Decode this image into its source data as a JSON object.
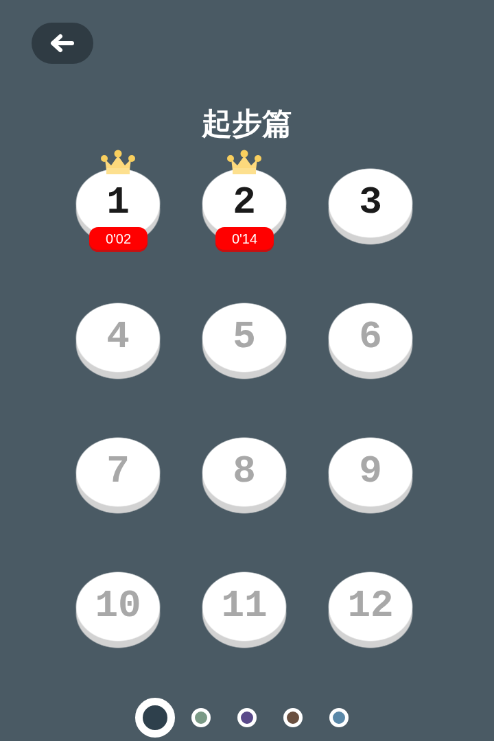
{
  "title": "起步篇",
  "levels": [
    {
      "number": "1",
      "locked": false,
      "crown": true,
      "time": "0'02"
    },
    {
      "number": "2",
      "locked": false,
      "crown": true,
      "time": "0'14"
    },
    {
      "number": "3",
      "locked": false,
      "crown": false
    },
    {
      "number": "4",
      "locked": true,
      "crown": false
    },
    {
      "number": "5",
      "locked": true,
      "crown": false
    },
    {
      "number": "6",
      "locked": true,
      "crown": false
    },
    {
      "number": "7",
      "locked": true,
      "crown": false
    },
    {
      "number": "8",
      "locked": true,
      "crown": false
    },
    {
      "number": "9",
      "locked": true,
      "crown": false
    },
    {
      "number": "10",
      "locked": true,
      "crown": false
    },
    {
      "number": "11",
      "locked": true,
      "crown": false
    },
    {
      "number": "12",
      "locked": true,
      "crown": false
    }
  ],
  "pages": [
    {
      "color": "#2e404c",
      "selected": true
    },
    {
      "color": "#7a9a86",
      "selected": false
    },
    {
      "color": "#5a4a8a",
      "selected": false
    },
    {
      "color": "#6a5040",
      "selected": false
    },
    {
      "color": "#5a88a8",
      "selected": false
    }
  ]
}
